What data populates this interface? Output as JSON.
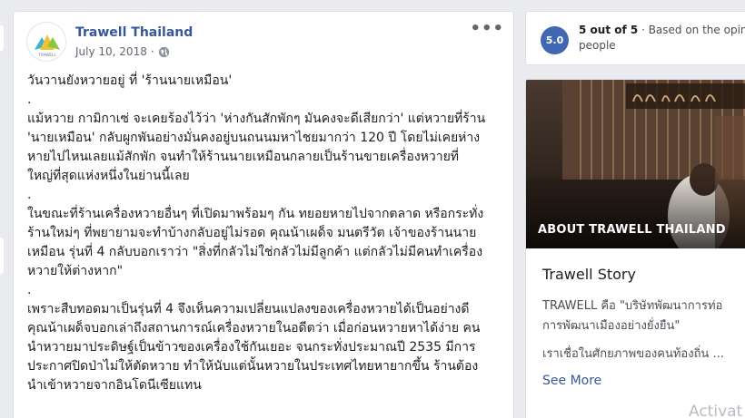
{
  "post": {
    "page_name": "Trawell Thailand",
    "date": "July 10, 2018",
    "dot": "·",
    "avatar_text": "TRAWELL",
    "more_label": "•••",
    "body": [
      "วันวานยังหวายอยู่ ที่ 'ร้านนายเหมือน'",
      ".",
      "แม้หวาย กามิกาเซ่ จะเคยร้องไว้ว่า 'ห่างกันสักพักๆ มันคงจะดีเสียกว่า' แต่หวายที่ร้าน\n'นายเหมือน' กลับผูกพันอย่างมั่นคงอยู่บนถนนมหาไชยมากว่า 120 ปี โดยไม่เคยห่าง\nหายไปไหนเลยแม้สักพัก จนทำให้ร้านนายเหมือนกลายเป็นร้านขายเครื่องหวายที่\nใหญ่ที่สุดแห่งหนึ่งในย่านนี้เลย",
      ".",
      "ในขณะที่ร้านเครื่องหวายอื่นๆ ที่เปิดมาพร้อมๆ กัน ทยอยหายไปจากตลาด หรือกระทั่ง\nร้านใหม่ๆ ที่พยายามจะทำบ้างกลับอยู่ไม่รอด คุณน้าเผด็จ มนตรีวัต เจ้าของร้านนาย\nเหมือน รุ่นที่ 4 กลับบอกเราว่า \"สิ่งที่กลัวไม่ใช่กลัวไม่มีลูกค้า แต่กลัวไม่มีคนทำเครื่อง\nหวายให้ต่างหาก\"",
      ".",
      "เพราะสืบทอดมาเป็นรุ่นที่ 4 จึงเห็นความเปลี่ยนแปลงของเครื่องหวายได้เป็นอย่างดี\nคุณน้าเผด็จบอกเล่าถึงสถานการณ์เครื่องหวายในอดีตว่า เมื่อก่อนหวายหาได้ง่าย คน\nนำหวายมาประดิษฐ์เป็นข้าวของเครื่องใช้กันเยอะ จนกระทั่งประมาณปี 2535 มีการ\nประกาศปิดป่าไม่ให้ตัดหวาย ทำให้นับแต่นั้นหวายในประเทศไทยหายากขึ้น ร้านต้อง\nนำเข้าหวายจากอินโดนีเซียแทน"
    ]
  },
  "rating": {
    "value": "5.0",
    "score_text": "5 out of 5",
    "dot": " · ",
    "basis_text": "Based on the opinio",
    "line2": "people"
  },
  "about": {
    "photo_caption": "ABOUT TRAWELL THAILAND",
    "story_title": "Trawell Story",
    "story_line1": "TRAWELL คือ \"บริษัทพัฒนาการท่อ",
    "story_line2": "การพัฒนาเมืองอย่างยั่งยืน\"",
    "story_line3": "เราเชื่อในศักยภาพของคนท้องถิ่น ...",
    "see_more": "See More"
  },
  "watermark": "Activat",
  "colors": {
    "page_bg": "#e9ebee",
    "link": "#365899",
    "badge": "#4267b2"
  }
}
